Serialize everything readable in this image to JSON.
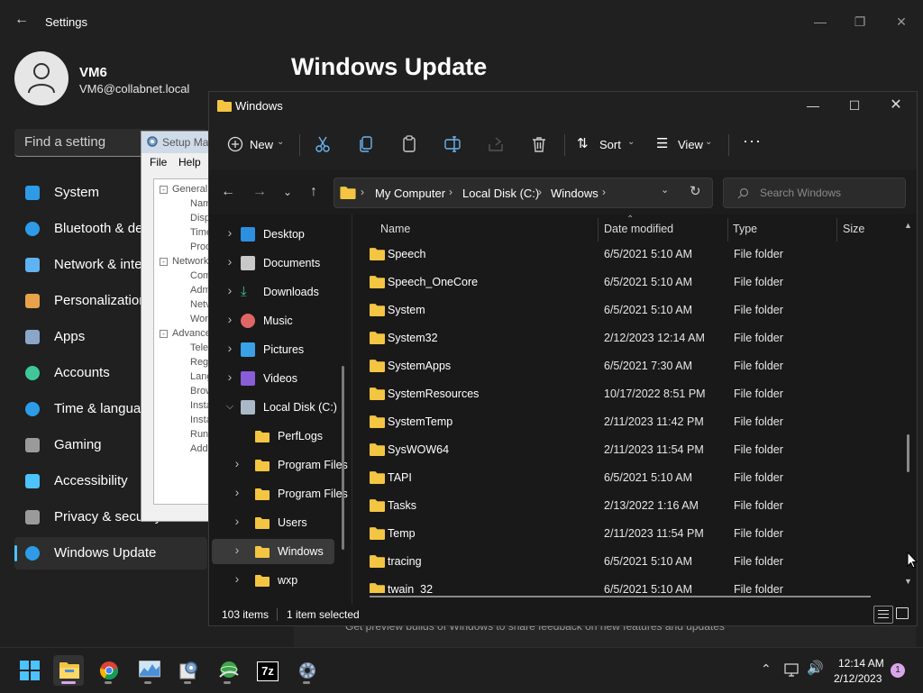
{
  "settings": {
    "title": "Settings",
    "user_name": "VM6",
    "user_email": "VM6@collabnet.local",
    "search_placeholder": "Find a setting",
    "page_title": "Windows Update",
    "preview_text": "Get preview builds of Windows to share feedback on new features and updates",
    "nav": [
      {
        "label": "System",
        "icon": "monitor-icon"
      },
      {
        "label": "Bluetooth & devices",
        "icon": "bluetooth-icon"
      },
      {
        "label": "Network & internet",
        "icon": "wifi-icon"
      },
      {
        "label": "Personalization",
        "icon": "brush-icon"
      },
      {
        "label": "Apps",
        "icon": "apps-icon"
      },
      {
        "label": "Accounts",
        "icon": "person-icon"
      },
      {
        "label": "Time & language",
        "icon": "clock-icon"
      },
      {
        "label": "Gaming",
        "icon": "gamepad-icon"
      },
      {
        "label": "Accessibility",
        "icon": "accessibility-icon"
      },
      {
        "label": "Privacy & security",
        "icon": "shield-icon"
      },
      {
        "label": "Windows Update",
        "icon": "update-icon"
      }
    ]
  },
  "setup_manager": {
    "title": "Setup Ma",
    "menu": [
      "File",
      "Help"
    ],
    "tree": [
      {
        "label": "General",
        "level": 0
      },
      {
        "label": "Nam",
        "level": 1
      },
      {
        "label": "Disp",
        "level": 1
      },
      {
        "label": "Time",
        "level": 1
      },
      {
        "label": "Prod",
        "level": 1
      },
      {
        "label": "Network",
        "level": 0
      },
      {
        "label": "Com",
        "level": 1
      },
      {
        "label": "Adm",
        "level": 1
      },
      {
        "label": "Netv",
        "level": 1
      },
      {
        "label": "Wor",
        "level": 1
      },
      {
        "label": "Advance",
        "level": 0
      },
      {
        "label": "Tele",
        "level": 1
      },
      {
        "label": "Regi",
        "level": 1
      },
      {
        "label": "Lang",
        "level": 1
      },
      {
        "label": "Brow",
        "level": 1
      },
      {
        "label": "Insta",
        "level": 1
      },
      {
        "label": "Insta",
        "level": 1
      },
      {
        "label": "Run",
        "level": 1
      },
      {
        "label": "Addi",
        "level": 1
      }
    ]
  },
  "explorer": {
    "title": "Windows",
    "toolbar": {
      "new": "New",
      "sort": "Sort",
      "view": "View"
    },
    "breadcrumb": [
      "My Computer",
      "Local Disk (C:)",
      "Windows"
    ],
    "search_placeholder": "Search Windows",
    "columns": {
      "name": "Name",
      "date": "Date modified",
      "type": "Type",
      "size": "Size"
    },
    "nav_tree": [
      {
        "label": "Desktop",
        "icon": "desktop-icon",
        "level": 0,
        "expand": ">"
      },
      {
        "label": "Documents",
        "icon": "documents-icon",
        "level": 0,
        "expand": ">"
      },
      {
        "label": "Downloads",
        "icon": "downloads-icon",
        "level": 0,
        "expand": ">"
      },
      {
        "label": "Music",
        "icon": "music-icon",
        "level": 0,
        "expand": ">"
      },
      {
        "label": "Pictures",
        "icon": "pictures-icon",
        "level": 0,
        "expand": ">"
      },
      {
        "label": "Videos",
        "icon": "videos-icon",
        "level": 0,
        "expand": ">"
      },
      {
        "label": "Local Disk (C:)",
        "icon": "drive-icon",
        "level": 0,
        "expand": "v"
      },
      {
        "label": "PerfLogs",
        "icon": "folder-icon",
        "level": 1,
        "expand": ""
      },
      {
        "label": "Program Files",
        "icon": "folder-icon",
        "level": 1,
        "expand": ">"
      },
      {
        "label": "Program Files",
        "icon": "folder-icon",
        "level": 1,
        "expand": ">"
      },
      {
        "label": "Users",
        "icon": "folder-icon",
        "level": 1,
        "expand": ">"
      },
      {
        "label": "Windows",
        "icon": "folder-icon",
        "level": 1,
        "expand": ">",
        "selected": true
      },
      {
        "label": "wxp",
        "icon": "folder-icon",
        "level": 1,
        "expand": ">"
      }
    ],
    "files": [
      {
        "name": "Speech",
        "date": "6/5/2021 5:10 AM",
        "type": "File folder"
      },
      {
        "name": "Speech_OneCore",
        "date": "6/5/2021 5:10 AM",
        "type": "File folder"
      },
      {
        "name": "System",
        "date": "6/5/2021 5:10 AM",
        "type": "File folder"
      },
      {
        "name": "System32",
        "date": "2/12/2023 12:14 AM",
        "type": "File folder"
      },
      {
        "name": "SystemApps",
        "date": "6/5/2021 7:30 AM",
        "type": "File folder"
      },
      {
        "name": "SystemResources",
        "date": "10/17/2022 8:51 PM",
        "type": "File folder"
      },
      {
        "name": "SystemTemp",
        "date": "2/11/2023 11:42 PM",
        "type": "File folder"
      },
      {
        "name": "SysWOW64",
        "date": "2/11/2023 11:54 PM",
        "type": "File folder"
      },
      {
        "name": "TAPI",
        "date": "6/5/2021 5:10 AM",
        "type": "File folder"
      },
      {
        "name": "Tasks",
        "date": "2/13/2022 1:16 AM",
        "type": "File folder"
      },
      {
        "name": "Temp",
        "date": "2/11/2023 11:54 PM",
        "type": "File folder"
      },
      {
        "name": "tracing",
        "date": "6/5/2021 5:10 AM",
        "type": "File folder"
      },
      {
        "name": "twain_32",
        "date": "6/5/2021 5:10 AM",
        "type": "File folder"
      }
    ],
    "status_count": "103 items",
    "status_selected": "1 item selected"
  },
  "taskbar": {
    "apps": [
      "start-icon",
      "file-explorer-icon",
      "chrome-icon",
      "resource-monitor-icon",
      "setup-manager-icon",
      "network-globe-icon",
      "7zip-icon",
      "settings-gear-icon"
    ],
    "app_7zip_label": "7z",
    "time": "12:14 AM",
    "date": "2/12/2023",
    "notification_count": "1"
  },
  "colors": {
    "accent": "#4cc2ff",
    "folder": "#f4c542",
    "taskbar_indicator": "#d8a6e8"
  }
}
